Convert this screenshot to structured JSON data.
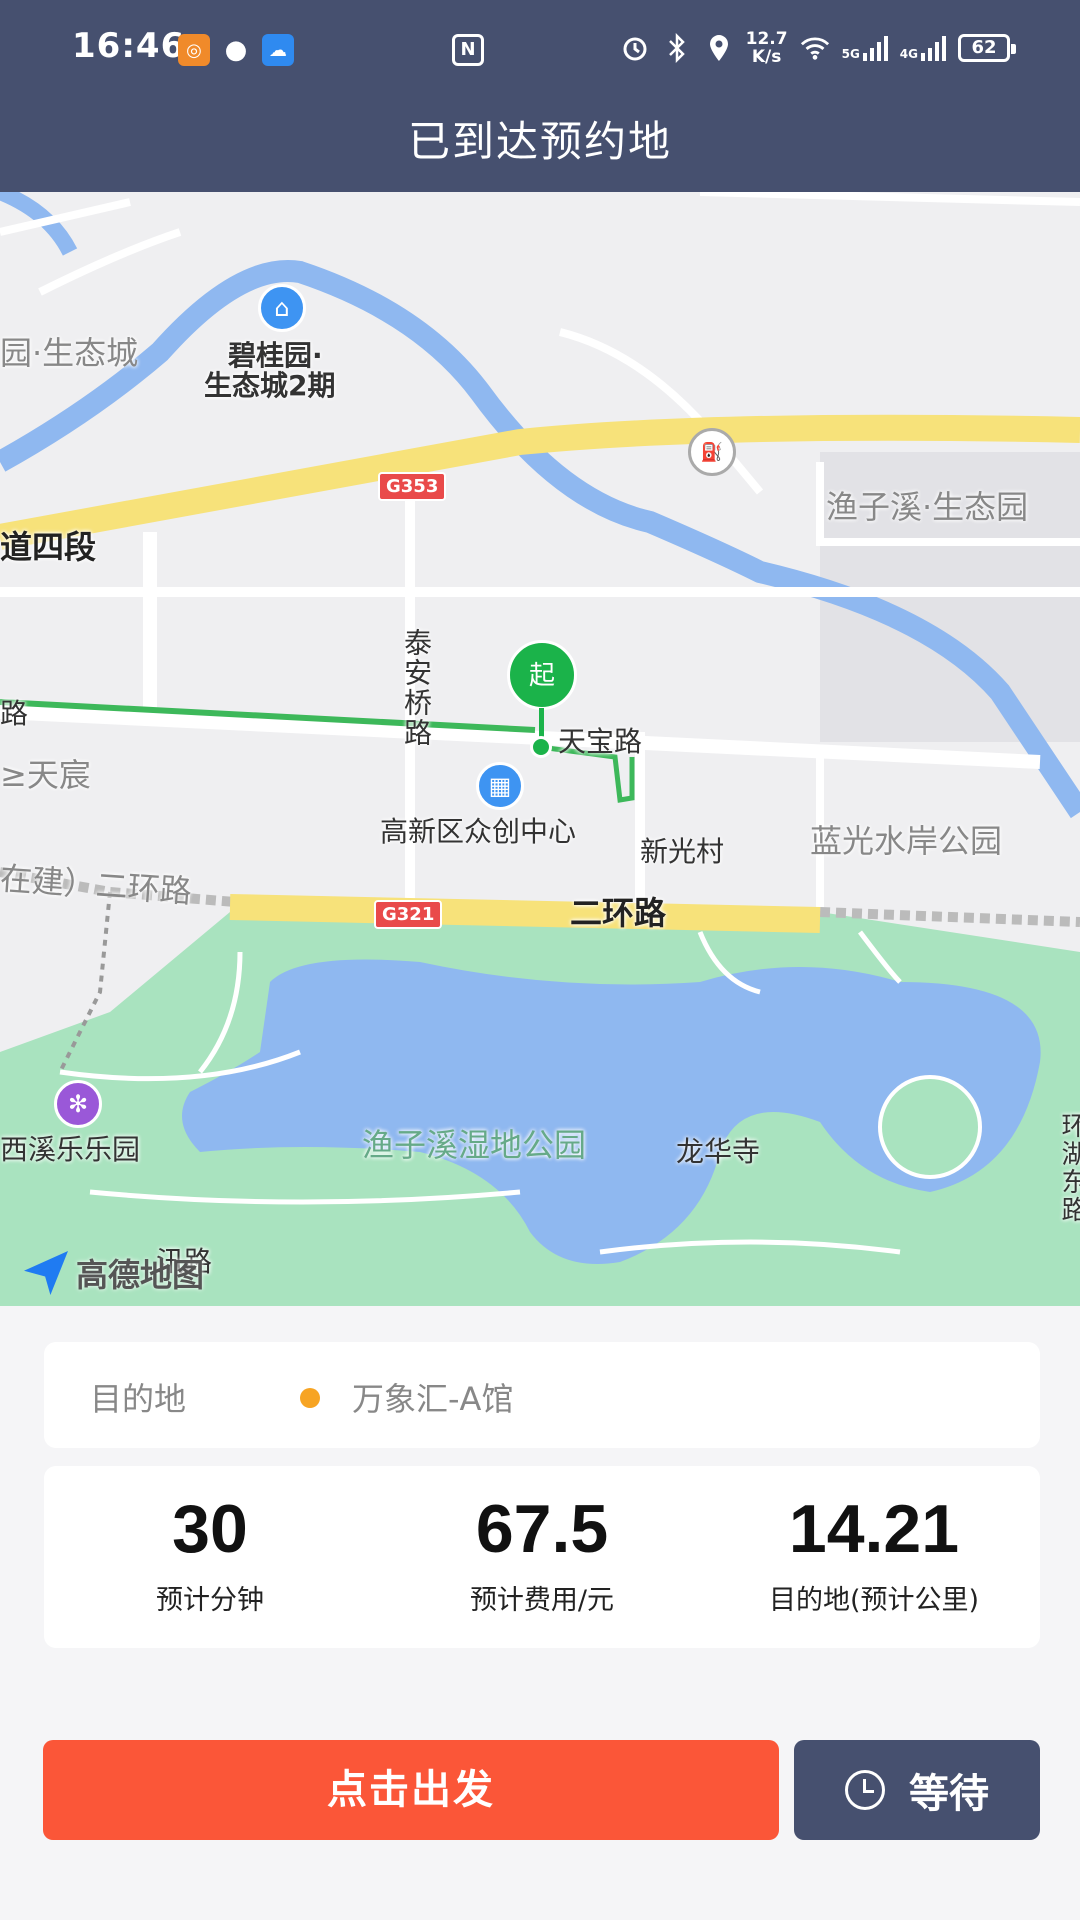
{
  "status_bar": {
    "time": "16:46",
    "net_speed_value": "12.7",
    "net_speed_unit": "K/s",
    "signal1": "5G",
    "signal2": "4G",
    "battery": "62",
    "nfc": "N"
  },
  "header": {
    "title": "已到达预约地"
  },
  "map": {
    "labels": {
      "bgy_line1": "碧桂园·",
      "bgy_line2": "生态城2期",
      "eco_left": "园·生态城",
      "yuzixi_eco": "渔子溪·生态园",
      "road_daosiduan": "道四段",
      "road_lu_left": "路",
      "taiantq": "泰安桥路",
      "tianbao": "天宝路",
      "tianchen": "≥天宸",
      "gaoxin": "高新区众创中心",
      "xinguang": "新光村",
      "languang": "蓝光水岸公园",
      "erhuan_left": "在建）二环路",
      "erhuan": "二环路",
      "xixi": "西溪乐乐园",
      "wetland": "渔子溪湿地公园",
      "longhua": "龙华寺",
      "side_right": "环湖东路",
      "sheng": "汛路"
    },
    "badges": {
      "g353": "G353",
      "g321": "G321"
    },
    "start_pin": "起",
    "logo": "高德地图",
    "colors": {
      "water": "#8fb8f0",
      "park": "#a9e3bf",
      "highway": "#f7e27a",
      "route": "#3db85a"
    }
  },
  "destination": {
    "label": "目的地",
    "value": "万象汇-A馆",
    "dot_color": "#f7a423"
  },
  "stats": [
    {
      "value": "30",
      "label": "预计分钟"
    },
    {
      "value": "67.5",
      "label": "预计费用/元"
    },
    {
      "value": "14.21",
      "label": "目的地(预计公里)"
    }
  ],
  "buttons": {
    "depart": "点击出发",
    "wait": "等待"
  }
}
